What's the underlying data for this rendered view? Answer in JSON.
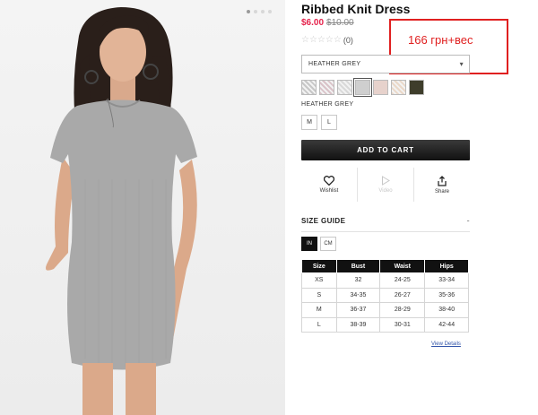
{
  "product": {
    "title": "Ribbed Knit Dress",
    "sale_price": "$6.00",
    "original_price": "$10.00",
    "rating_count": "(0)",
    "stars": 0
  },
  "annotation": {
    "text": "166 грн+вес",
    "color": "#e02020"
  },
  "color_select": {
    "value": "HEATHER GREY"
  },
  "swatches": [
    {
      "name": "grey-check",
      "color": "#c7c7c7"
    },
    {
      "name": "pink-check",
      "color": "#d9c2c8"
    },
    {
      "name": "light-check",
      "color": "#d9d9d9"
    },
    {
      "name": "heather-grey",
      "color": "#cfcfcf",
      "selected": true
    },
    {
      "name": "blush",
      "color": "#e7d2cc"
    },
    {
      "name": "peach-check",
      "color": "#ead8c8"
    },
    {
      "name": "olive",
      "color": "#3e3d2b"
    }
  ],
  "selected_color_label": "HEATHER GREY",
  "sizes": [
    "M",
    "L"
  ],
  "add_to_cart": "ADD TO CART",
  "actions": {
    "wishlist": "Wishlist",
    "video": "Video",
    "share": "Share"
  },
  "size_guide": {
    "title": "SIZE GUIDE",
    "toggle": "-",
    "units": [
      "IN",
      "CM"
    ],
    "active_unit": "IN",
    "headers": [
      "Size",
      "Bust",
      "Waist",
      "Hips"
    ],
    "rows": [
      [
        "XS",
        "32",
        "24-25",
        "33-34"
      ],
      [
        "S",
        "34-35",
        "26-27",
        "35-36"
      ],
      [
        "M",
        "36-37",
        "28-29",
        "38-40"
      ],
      [
        "L",
        "38-39",
        "30-31",
        "42-44"
      ]
    ],
    "view_details": "View Details"
  },
  "colors": {
    "sale": "#e5224b",
    "cart_button": "#111111",
    "table_header": "#111111"
  }
}
